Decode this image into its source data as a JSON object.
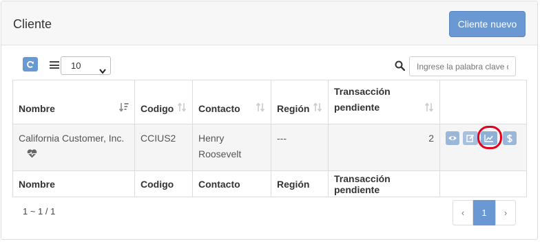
{
  "header": {
    "title": "Cliente",
    "new_button": "Cliente nuevo"
  },
  "toolbar": {
    "refresh_icon": "refresh-icon",
    "menu_icon": "list-icon",
    "page_size": "10",
    "search_icon": "search-icon",
    "search_placeholder": "Ingrese la palabra clave d"
  },
  "table": {
    "headers": [
      "Nombre",
      "Codigo",
      "Contacto",
      "Región",
      "Transacción pendiente"
    ],
    "rows": [
      {
        "nombre": "California Customer, Inc.",
        "nombre_icon": "heartbeat-icon",
        "codigo": "CCIUS2",
        "contacto": "Henry Roosevelt",
        "region": "---",
        "transaccion": "2",
        "actions": [
          "eye-icon",
          "edit-icon",
          "chart-icon",
          "dollar-icon"
        ]
      }
    ],
    "footer": [
      "Nombre",
      "Codigo",
      "Contacto",
      "Región",
      "Transacción pendiente"
    ]
  },
  "pagination": {
    "info": "1 ~ 1 / 1",
    "prev": "‹",
    "current": "1",
    "next": "›"
  },
  "colors": {
    "primary": "#6a98d2",
    "action": "#9ab6d8",
    "highlight": "#e3001b"
  }
}
